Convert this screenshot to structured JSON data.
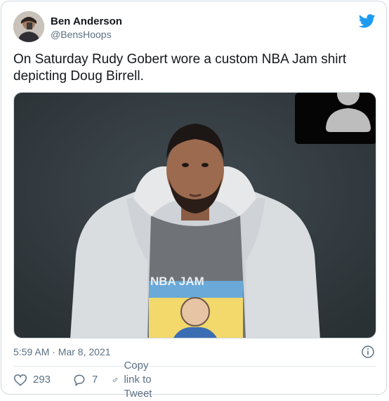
{
  "tweet": {
    "author": {
      "display_name": "Ben Anderson",
      "handle": "@BensHoops"
    },
    "text": "On Saturday Rudy Gobert wore a custom NBA Jam shirt depicting Doug Birrell.",
    "media": {
      "shirt_text": "NBA JAM"
    },
    "timestamp": "5:59 AM · Mar 8, 2021",
    "actions": {
      "likes": "293",
      "replies": "7",
      "copy_link_label": "Copy link to Tweet"
    }
  },
  "colors": {
    "twitter_blue": "#1d9bf0",
    "secondary_text": "#5b7083",
    "border": "#cfd9de"
  },
  "icons": {
    "brand": "twitter-bird-icon",
    "info": "info-icon",
    "like": "heart-icon",
    "reply": "reply-bubble-icon",
    "copy_link": "link-icon"
  }
}
